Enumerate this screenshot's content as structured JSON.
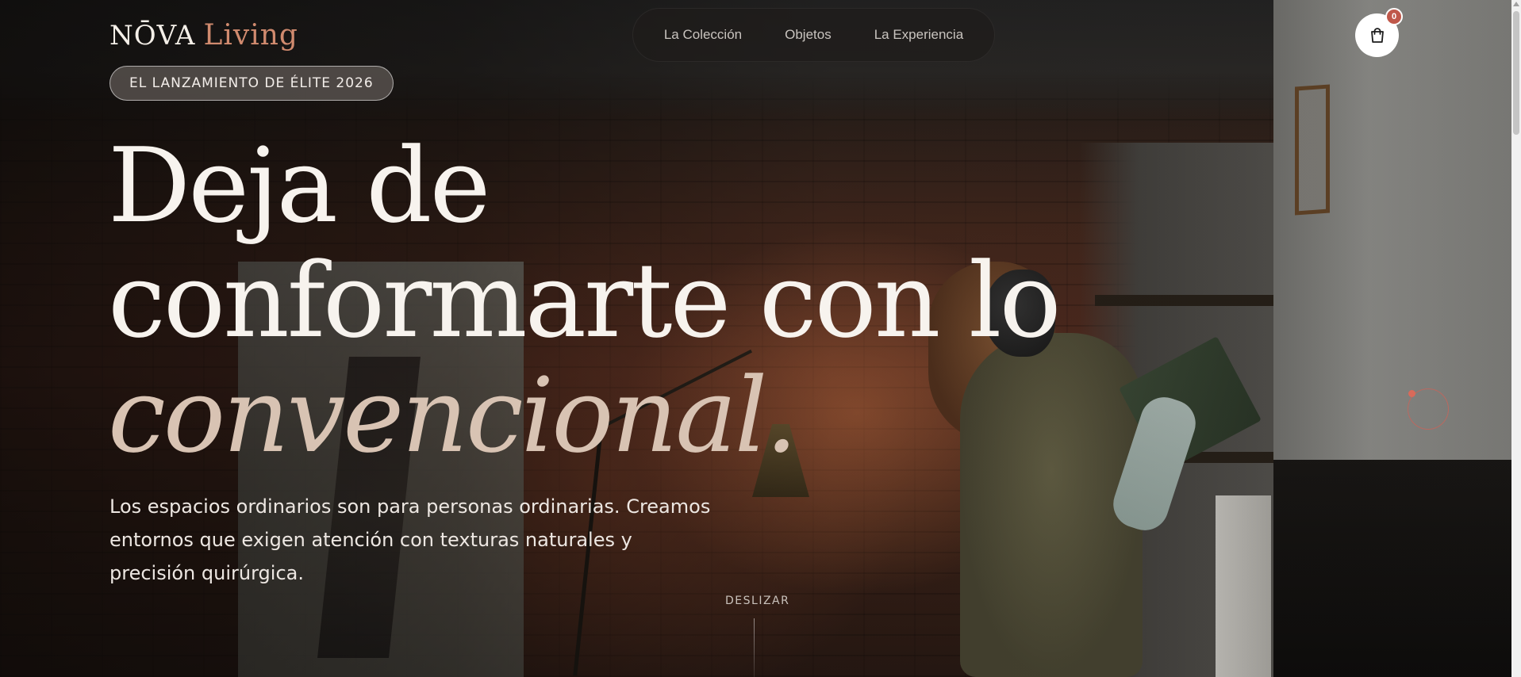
{
  "brand": {
    "name": "NŌVA",
    "accent": "Living",
    "accent_color": "#d08a6e"
  },
  "nav": {
    "items": [
      {
        "label": "La Colección"
      },
      {
        "label": "Objetos"
      },
      {
        "label": "La Experiencia"
      }
    ]
  },
  "cart": {
    "icon": "shopping-bag-icon",
    "count": "0",
    "badge_color": "#c0584a"
  },
  "hero": {
    "badge": "EL LANZAMIENTO DE ÉLITE 2026",
    "headline_line1": "Deja de",
    "headline_line2": "conformarte con lo",
    "headline_line3": "convencional.",
    "subtext": "Los espacios ordinarios son para personas ordinarias. Creamos entornos que exigen atención con texturas naturales y precisión quirúrgica.",
    "scroll_label": "DESLIZAR"
  }
}
